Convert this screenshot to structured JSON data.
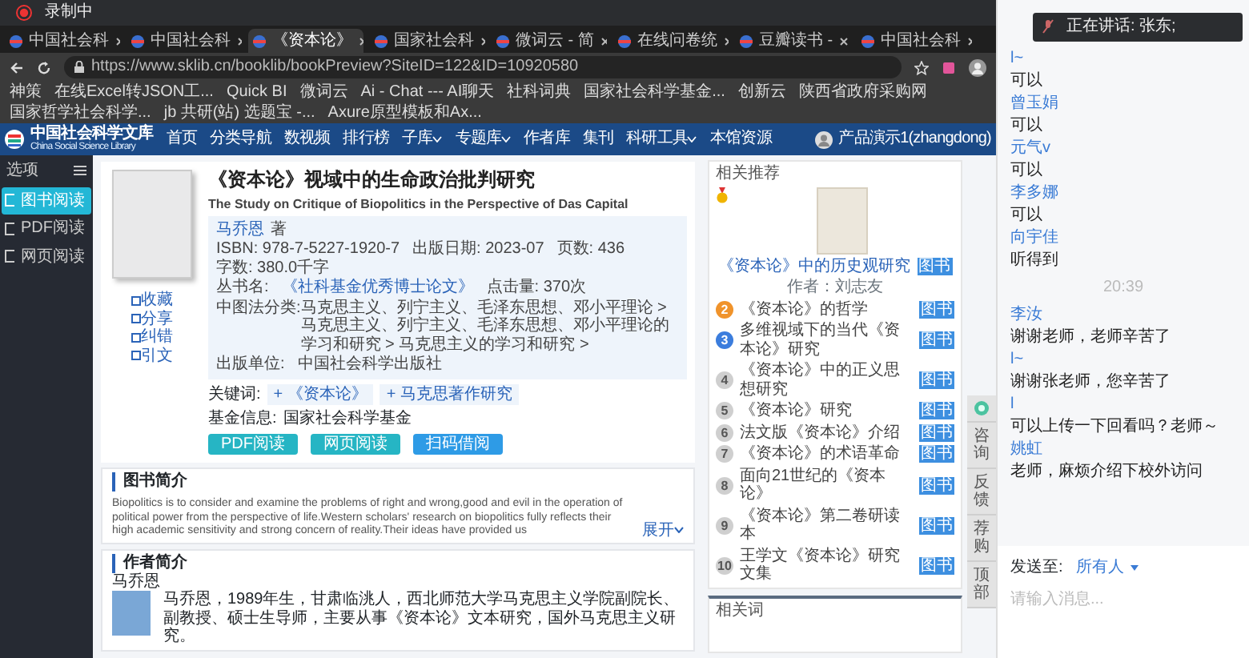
{
  "recording": {
    "label": "录制中"
  },
  "browser": {
    "tabs": [
      {
        "title": "中国社会科",
        "selected": false
      },
      {
        "title": "中国社会科",
        "selected": false
      },
      {
        "title": "《资本论》",
        "selected": true
      },
      {
        "title": "国家社会科",
        "selected": false
      },
      {
        "title": "微词云 - 简",
        "selected": false
      },
      {
        "title": "在线问卷统",
        "selected": false
      },
      {
        "title": "豆瓣读书 -",
        "selected": false
      },
      {
        "title": "中国社会科",
        "selected": false
      }
    ],
    "url": "https://www.sklib.cn/booklib/bookPreview?SiteID=122&ID=10920580",
    "bookmarks": [
      "神策",
      "在线Excel转JSON工...",
      "Quick BI",
      "微词云",
      "Ai - Chat --- AI聊天",
      "社科词典",
      "国家社会科学基金...",
      "创新云",
      "陕西省政府采购网",
      "国家哲学社会科学...",
      "jb 共研(站) 选题宝 -...",
      "Axure原型模板和Ax..."
    ]
  },
  "site": {
    "logo_title": "中国社会科学文库",
    "logo_subtitle": "China Social Science Library",
    "nav": [
      {
        "label": "首页",
        "dropdown": false
      },
      {
        "label": "分类导航",
        "dropdown": false
      },
      {
        "label": "数视频",
        "dropdown": false
      },
      {
        "label": "排行榜",
        "dropdown": false
      },
      {
        "label": "子库",
        "dropdown": true
      },
      {
        "label": "专题库",
        "dropdown": true
      },
      {
        "label": "作者库",
        "dropdown": false
      },
      {
        "label": "集刊",
        "dropdown": false
      },
      {
        "label": "科研工具",
        "dropdown": true
      },
      {
        "label": "本馆资源",
        "dropdown": false
      }
    ],
    "user": "产品演示1(zhangdong)"
  },
  "sidebar": {
    "title": "选项",
    "items": [
      {
        "label": "图书阅读",
        "selected": true
      },
      {
        "label": "PDF阅读",
        "selected": false
      },
      {
        "label": "网页阅读",
        "selected": false
      }
    ]
  },
  "book": {
    "title": "《资本论》视域中的生命政治批判研究",
    "subtitle": "The Study on Critique of Biopolitics in the Perspective of Das Capital",
    "author": "马乔恩",
    "author_suffix": "著",
    "fields": [
      {
        "label": "ISBN:",
        "value": "978-7-5227-1920-7"
      },
      {
        "label": "出版日期:",
        "value": "2023-07"
      },
      {
        "label": "页数:",
        "value": "436"
      },
      {
        "label": "字数:",
        "value": "380.0千字"
      }
    ],
    "series_label": "丛书名:",
    "series": "《社科基金优秀博士论文》",
    "clicks_label": "点击量:",
    "clicks": "370次",
    "category_label": "中图法分类:",
    "categories": [
      "马克思主义、列宁主义、毛泽东思想、邓小平理论 >",
      "马克思主义、列宁主义、毛泽东思想、邓小平理论的学习和研究 > 马克思主义的学习和研究 >"
    ],
    "publisher_label": "出版单位:",
    "publisher": "中国社会科学出版社",
    "actions": [
      "收藏",
      "分享",
      "纠错",
      "引文"
    ],
    "keywords_label": "关键词:",
    "keywords": [
      "+ 《资本论》",
      "+ 马克思著作研究"
    ],
    "fund_label": "基金信息:",
    "fund": "国家社会科学基金",
    "buttons": [
      "PDF阅读",
      "网页阅读",
      "扫码借阅"
    ]
  },
  "intro": {
    "title": "图书简介",
    "text": "Biopolitics is to consider and examine the problems of right and wrong,good and evil in the operation of political power from the perspective of life.Western scholars' research on biopolitics fully reflects their high academic sensitivity and strong concern of reality.Their ideas have provided us",
    "more": "展开"
  },
  "author_section": {
    "title": "作者简介",
    "name": "马乔恩",
    "bio": "马乔恩，1989年生，甘肃临洮人，西北师范大学马克思主义学院副院长、副教授、硕士生导师，主要从事《资本论》文本研究，国外马克思主义研究。"
  },
  "related": {
    "title": "相关推荐",
    "featured": {
      "title": "《资本论》中的历史观研究",
      "tag": "图书",
      "author": "作者：刘志友"
    },
    "items": [
      {
        "rank": "2",
        "title": "《资本论》的哲学",
        "tag": "图书",
        "color": "#f0932b"
      },
      {
        "rank": "3",
        "title": "多维视域下的当代《资本论》研究",
        "tag": "图书",
        "color": "#3b7ddd"
      },
      {
        "rank": "4",
        "title": "《资本论》中的正义思想研究",
        "tag": "图书",
        "color": "#cfcfcf"
      },
      {
        "rank": "5",
        "title": "《资本论》研究",
        "tag": "图书",
        "color": "#cfcfcf"
      },
      {
        "rank": "6",
        "title": "法文版《资本论》介绍",
        "tag": "图书",
        "color": "#cfcfcf"
      },
      {
        "rank": "7",
        "title": "《资本论》的术语革命",
        "tag": "图书",
        "color": "#cfcfcf"
      },
      {
        "rank": "8",
        "title": "面向21世纪的《资本论》",
        "tag": "图书",
        "color": "#cfcfcf"
      },
      {
        "rank": "9",
        "title": "《资本论》第二卷研读本",
        "tag": "图书",
        "color": "#cfcfcf"
      },
      {
        "rank": "10",
        "title": "王学文《资本论》研究文集",
        "tag": "图书",
        "color": "#cfcfcf"
      }
    ],
    "words_title": "相关词"
  },
  "side_tabs": [
    "咨询",
    "反馈",
    "荐购",
    "顶部"
  ],
  "chat": {
    "speaking": "正在讲话: 张东;",
    "messages": [
      {
        "kind": "message",
        "name": "l~",
        "text": "可以"
      },
      {
        "kind": "message",
        "name": "曾玉娟",
        "text": "可以"
      },
      {
        "kind": "message",
        "name": "元气v",
        "text": "可以"
      },
      {
        "kind": "message",
        "name": "李多娜",
        "text": "可以"
      },
      {
        "kind": "message",
        "name": "向宇佳",
        "text": "听得到"
      },
      {
        "kind": "time",
        "text": "20:39"
      },
      {
        "kind": "message",
        "name": "李汝",
        "text": "谢谢老师，老师辛苦了"
      },
      {
        "kind": "message",
        "name": "l~",
        "text": "谢谢张老师，您辛苦了"
      },
      {
        "kind": "message",
        "name": "l",
        "text": "可以上传一下回看吗？老师～"
      },
      {
        "kind": "message",
        "name": "姚虹",
        "text": "老师，麻烦介绍下校外访问"
      }
    ],
    "send_to_label": "发送至:",
    "send_to": "所有人",
    "placeholder": "请输入消息..."
  }
}
